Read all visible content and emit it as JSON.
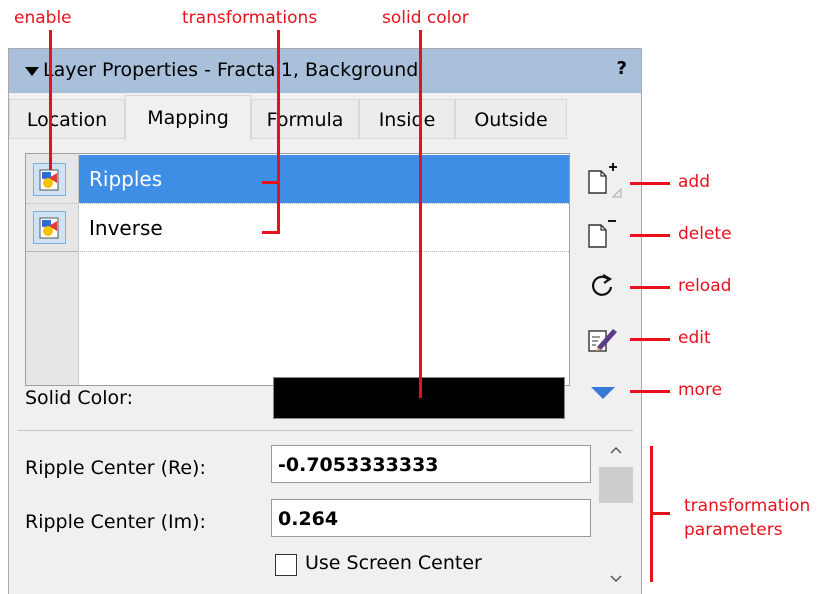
{
  "annotations": {
    "enable": "enable",
    "transformations": "transformations",
    "solid_color": "solid color",
    "add": "add",
    "delete": "delete",
    "reload": "reload",
    "edit": "edit",
    "more": "more",
    "params_line1": "transformation",
    "params_line2": "parameters"
  },
  "panel": {
    "title": "Layer Properties - Fractal1, Background",
    "help": "?"
  },
  "tabs": [
    {
      "label": "Location",
      "active": false
    },
    {
      "label": "Mapping",
      "active": true
    },
    {
      "label": "Formula",
      "active": false
    },
    {
      "label": "Inside",
      "active": false
    },
    {
      "label": "Outside",
      "active": false
    }
  ],
  "transformations": [
    {
      "name": "Ripples",
      "selected": true
    },
    {
      "name": "Inverse",
      "selected": false
    }
  ],
  "solid_color": {
    "label": "Solid Color:",
    "value": "#000000"
  },
  "parameters": {
    "re_label": "Ripple Center (Re):",
    "re_value": "-0.7053333333",
    "im_label": "Ripple Center (Im):",
    "im_value": "0.264",
    "use_center_label": "Use Screen Center",
    "use_center_checked": false
  },
  "colors": {
    "annotation": "#e8111b",
    "titlebar": "#a9c0db",
    "selection": "#3d8ee4",
    "more_triangle": "#3a78d8"
  }
}
